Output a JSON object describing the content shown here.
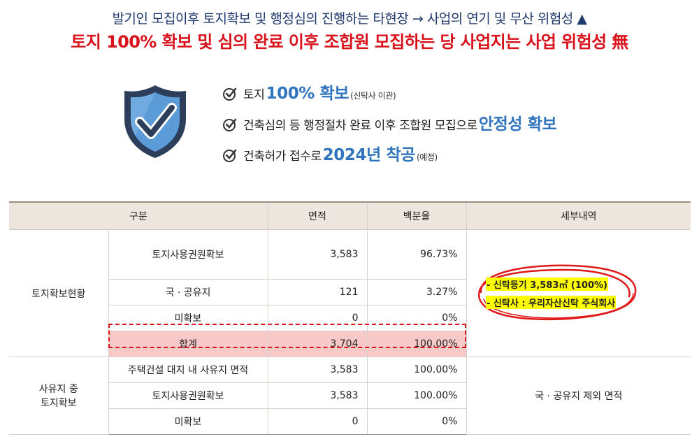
{
  "headline": {
    "line1": "발기인 모집이후 토지확보 및 행정심의 진행하는 타현장 → 사업의 연기 및 무산 위험성 ▲",
    "line2": "토지 100% 확보 및 심의 완료 이후 조합원 모집하는 당 사업지는 사업 위험성 無"
  },
  "checks": [
    {
      "pre": "토지 ",
      "highlight": "100% 확보",
      "suffix": "(신탁사 이관)"
    },
    {
      "pre": "건축심의 등 행정절차 완료 이후 조합원 모집으로 ",
      "highlight": "안정성 확보",
      "suffix": ""
    },
    {
      "pre": "건축허가 접수로 ",
      "highlight": "2024년 착공",
      "suffix": "(예정)"
    }
  ],
  "table": {
    "headers": [
      "구분",
      "면적",
      "백분율",
      "세부내역"
    ],
    "group1": {
      "label": "토지확보현황",
      "rows": [
        {
          "name": "토지사용권원확보",
          "area": "3,583",
          "pct": "96.73%"
        },
        {
          "name": "국 · 공유지",
          "area": "121",
          "pct": "3.27%"
        },
        {
          "name": "미확보",
          "area": "0",
          "pct": "0%"
        },
        {
          "name": "합계",
          "area": "3,704",
          "pct": "100.00%"
        }
      ],
      "detail": [
        "- 신탁등기 3,583㎡ (100%)",
        "- 신탁사 : 우리자산신탁 주식회사"
      ]
    },
    "group2": {
      "label_line1": "사유지 중",
      "label_line2": "토지확보",
      "rows": [
        {
          "name": "주택건설 대지 내 사유지 면적",
          "area": "3,583",
          "pct": "100.00%"
        },
        {
          "name": "토지사용권원확보",
          "area": "3,583",
          "pct": "100.00%"
        },
        {
          "name": "미확보",
          "area": "0",
          "pct": "0%"
        }
      ],
      "detail": "국 · 공유지 제외 면적"
    }
  },
  "colors": {
    "navy": "#1f3a6e",
    "red": "#d9121b",
    "blue": "#2f74bd",
    "header_bg": "#ece6de",
    "total_bg": "#f8c9c9"
  }
}
